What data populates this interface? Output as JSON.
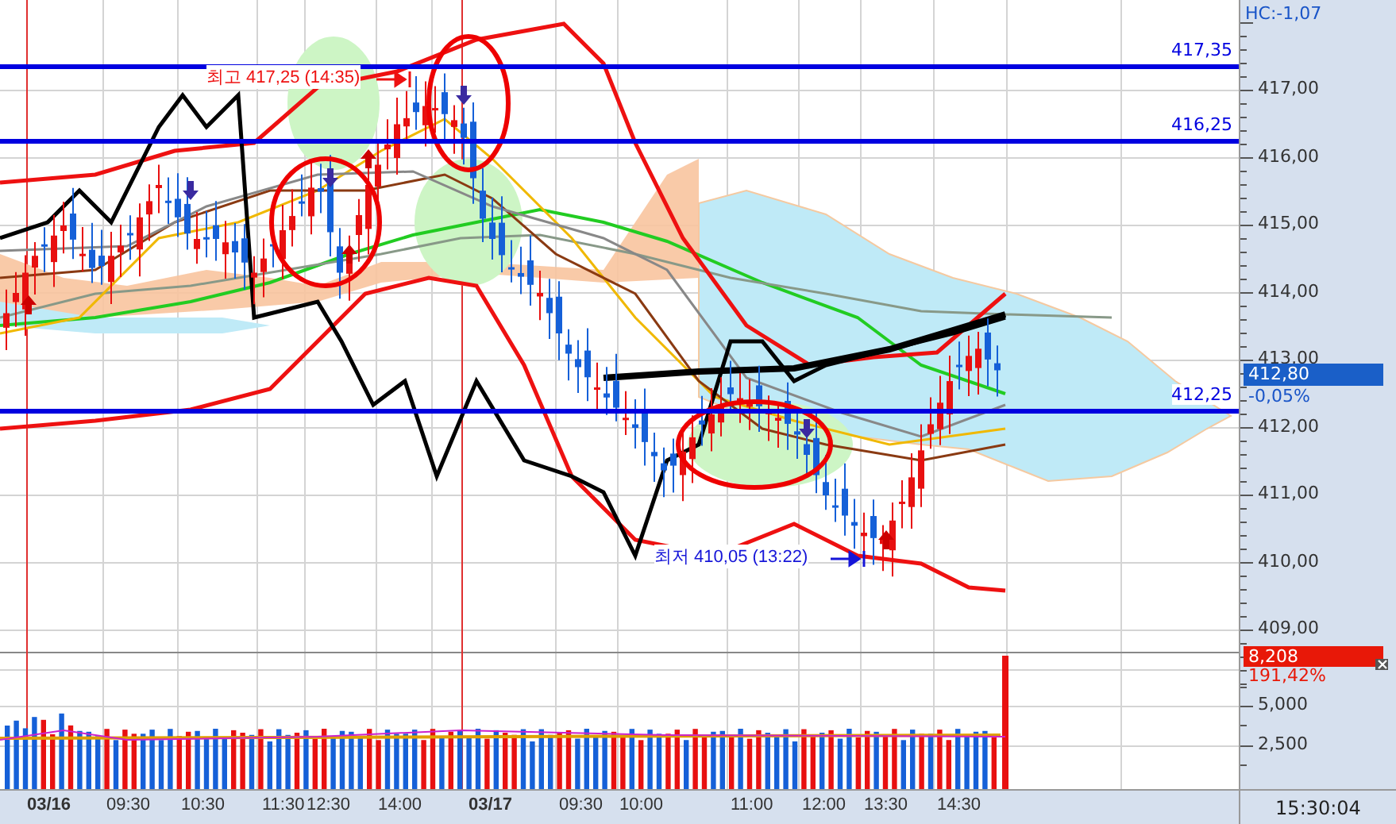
{
  "price_axis": {
    "ticks": [
      "417,00",
      "416,00",
      "415,00",
      "414,00",
      "413,00",
      "412,00",
      "411,00",
      "410,00",
      "409,00"
    ],
    "hc": "HC:-1,07",
    "current_price": "412,80",
    "current_change": "-0,05%"
  },
  "level_lines": [
    {
      "label": "417,35"
    },
    {
      "label": "416,25"
    },
    {
      "label": "412,25"
    }
  ],
  "annotations": [
    {
      "kind": "high",
      "text": "최고 417,25 (14:35)"
    },
    {
      "kind": "low",
      "text": "최저 410,05 (13:22)"
    }
  ],
  "volume_axis": {
    "ticks": [
      "5,000",
      "2,500"
    ],
    "current_volume": "8,208",
    "volume_ratio": "191,42%"
  },
  "time_axis": [
    {
      "kind": "date",
      "label": "03/16"
    },
    {
      "kind": "time",
      "label": "09:30"
    },
    {
      "kind": "time",
      "label": "10:30"
    },
    {
      "kind": "time",
      "label": "11:30"
    },
    {
      "kind": "time",
      "label": "12:30"
    },
    {
      "kind": "time",
      "label": "14:00"
    },
    {
      "kind": "date",
      "label": "03/17"
    },
    {
      "kind": "time",
      "label": "09:30"
    },
    {
      "kind": "time",
      "label": "10:00"
    },
    {
      "kind": "time",
      "label": "11:00"
    },
    {
      "kind": "time",
      "label": "12:00"
    },
    {
      "kind": "time",
      "label": "13:30"
    },
    {
      "kind": "time",
      "label": "14:30"
    }
  ],
  "clock": "15:30:04"
}
